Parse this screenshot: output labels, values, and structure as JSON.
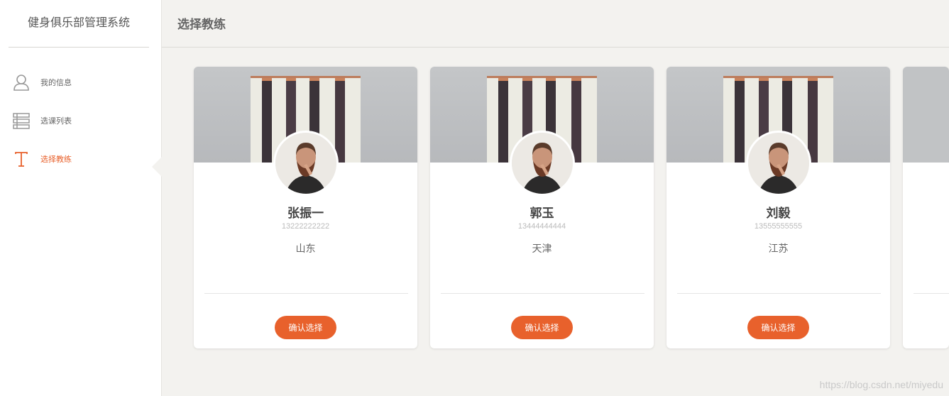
{
  "app": {
    "title": "健身俱乐部管理系统"
  },
  "sidebar": {
    "items": [
      {
        "label": "我的信息",
        "icon": "user-icon",
        "active": false
      },
      {
        "label": "选课列表",
        "icon": "list-icon",
        "active": false
      },
      {
        "label": "选择教练",
        "icon": "text-t-icon",
        "active": true
      }
    ]
  },
  "header": {
    "title": "选择教练"
  },
  "coaches": [
    {
      "name": "张振一",
      "phone": "13222222222",
      "city": "山东",
      "button": "确认选择"
    },
    {
      "name": "郭玉",
      "phone": "13444444444",
      "city": "天津",
      "button": "确认选择"
    },
    {
      "name": "刘毅",
      "phone": "13555555555",
      "city": "江苏",
      "button": "确认选择"
    }
  ],
  "watermark": "https://blog.csdn.net/miyedu",
  "colors": {
    "accent": "#e8612c",
    "background": "#f3f2ef",
    "card": "#ffffff",
    "muted_text": "#bbbbbb"
  }
}
